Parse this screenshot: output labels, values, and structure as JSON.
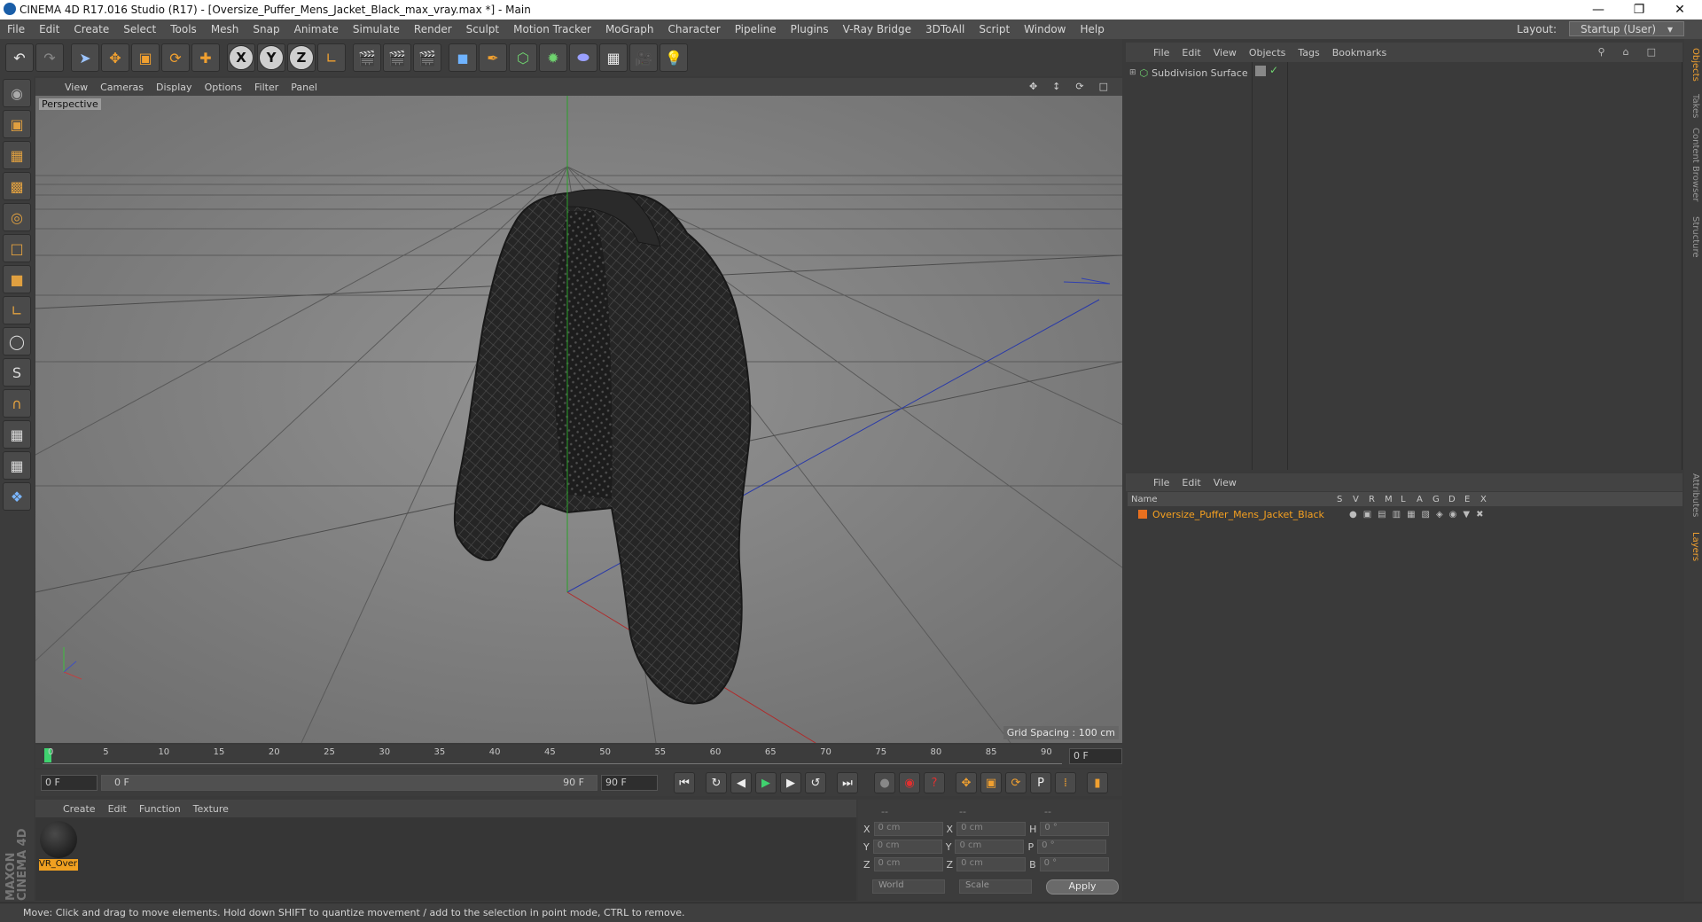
{
  "window": {
    "title": "CINEMA 4D R17.016 Studio (R17) - [Oversize_Puffer_Mens_Jacket_Black_max_vray.max *] - Main"
  },
  "menubar": [
    "File",
    "Edit",
    "Create",
    "Select",
    "Tools",
    "Mesh",
    "Snap",
    "Animate",
    "Simulate",
    "Render",
    "Sculpt",
    "Motion Tracker",
    "MoGraph",
    "Character",
    "Pipeline",
    "Plugins",
    "V-Ray Bridge",
    "3DToAll",
    "Script",
    "Window",
    "Help"
  ],
  "layout": {
    "label": "Layout:",
    "value": "Startup (User)"
  },
  "viewport": {
    "menu": [
      "View",
      "Cameras",
      "Display",
      "Options",
      "Filter",
      "Panel"
    ],
    "label": "Perspective",
    "grid_spacing": "Grid Spacing : 100 cm"
  },
  "timeline": {
    "ticks": [
      "0",
      "5",
      "10",
      "15",
      "20",
      "25",
      "30",
      "35",
      "40",
      "45",
      "50",
      "55",
      "60",
      "65",
      "70",
      "75",
      "80",
      "85",
      "90"
    ],
    "current_frame": "0 F",
    "start_frame": "0 F",
    "range_start": "0 F",
    "range_end": "90 F",
    "end_frame": "90 F"
  },
  "materials": {
    "menu": [
      "Create",
      "Edit",
      "Function",
      "Texture"
    ],
    "item_label": "VR_Over"
  },
  "coordinates": {
    "headers": [
      "--",
      "--",
      "--"
    ],
    "rows": [
      {
        "a": "X",
        "av": "0 cm",
        "b": "X",
        "bv": "0 cm",
        "c": "H",
        "cv": "0 °"
      },
      {
        "a": "Y",
        "av": "0 cm",
        "b": "Y",
        "bv": "0 cm",
        "c": "P",
        "cv": "0 °"
      },
      {
        "a": "Z",
        "av": "0 cm",
        "b": "Z",
        "bv": "0 cm",
        "c": "B",
        "cv": "0 °"
      }
    ],
    "mode1": "World",
    "mode2": "Scale",
    "apply": "Apply"
  },
  "objects": {
    "menu": [
      "File",
      "Edit",
      "View",
      "Objects",
      "Tags",
      "Bookmarks"
    ],
    "item": "Subdivision Surface"
  },
  "layers": {
    "menu": [
      "File",
      "Edit",
      "View"
    ],
    "columns": [
      "Name",
      "S",
      "V",
      "R",
      "M",
      "L",
      "A",
      "G",
      "D",
      "E",
      "X"
    ],
    "item": "Oversize_Puffer_Mens_Jacket_Black"
  },
  "sidetabs": [
    "Objects",
    "Takes",
    "Content Browser",
    "Structure",
    "Attributes",
    "Layers"
  ],
  "brand": "MAXON CINEMA 4D",
  "status": "Move: Click and drag to move elements. Hold down SHIFT to quantize movement / add to the selection in point mode, CTRL to remove."
}
